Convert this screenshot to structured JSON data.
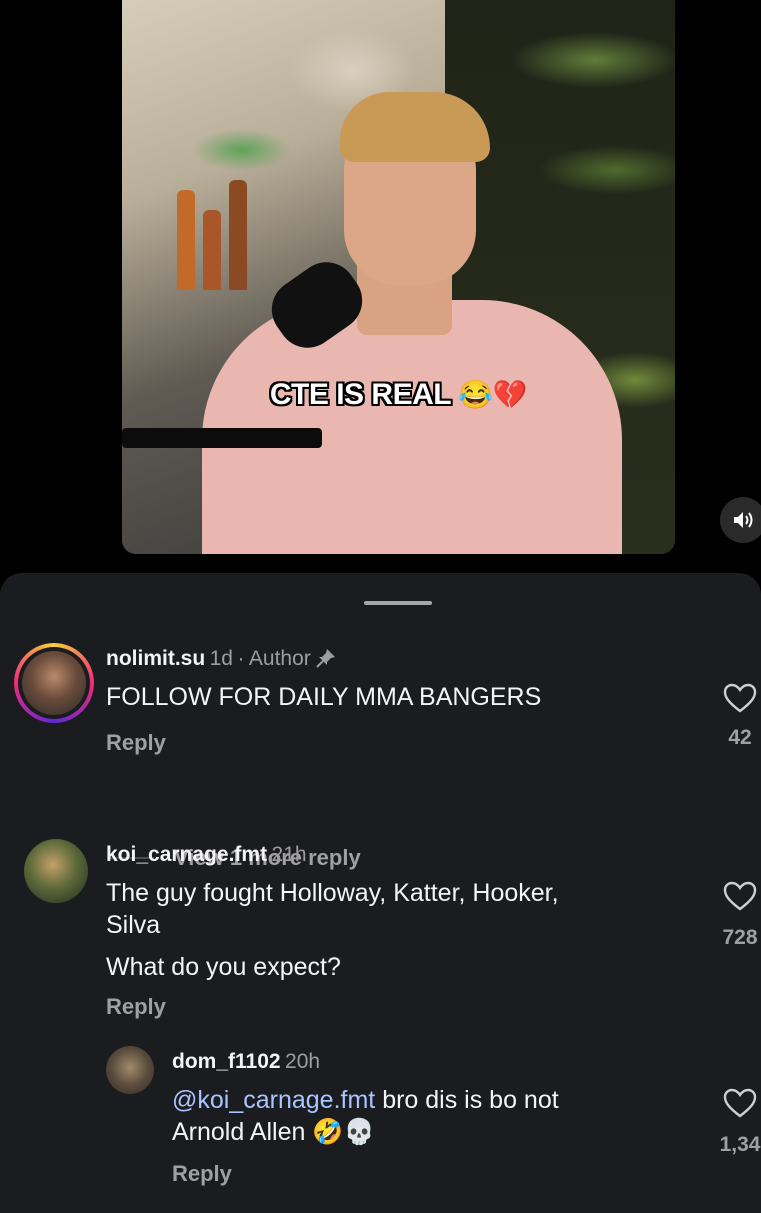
{
  "video": {
    "caption_text": "CTE IS REAL",
    "caption_emoji": "😂💔",
    "volume_icon": "speaker-icon"
  },
  "comments": [
    {
      "username": "nolimit.su",
      "time": "1d",
      "separator": "·",
      "role": "Author",
      "pinned_icon": "pin-icon",
      "text": "FOLLOW FOR DAILY MMA BANGERS",
      "reply_label": "Reply",
      "likes": "42",
      "view_more": "View 1 more reply",
      "avatar_ring": "#e1306c"
    },
    {
      "username": "koi_carnage.fmt",
      "time": "21h",
      "text_line1": "The guy fought Holloway, Katter, Hooker,",
      "text_line2": "Silva",
      "text_line3": "What do you expect?",
      "reply_label": "Reply",
      "likes": "728"
    },
    {
      "username": "dom_f1102",
      "time": "20h",
      "mention": "@koi_carnage.fmt",
      "text_rest": " bro dis is bo not",
      "text_line2": "Arnold Allen",
      "text_emoji": "🤣💀",
      "reply_label": "Reply",
      "likes": "1,34"
    }
  ],
  "colors": {
    "sheet_bg": "#1b1c1f",
    "mention": "#a9c4ff",
    "muted": "#a0a0a0"
  }
}
